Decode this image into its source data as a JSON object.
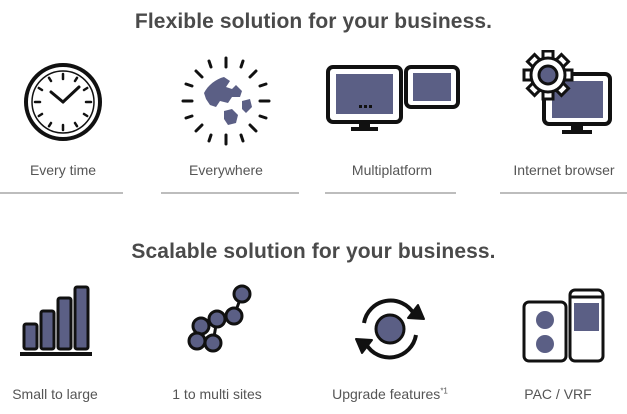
{
  "sections": [
    {
      "title": "Flexible solution for your business.",
      "features": [
        {
          "label": "Every time",
          "icon": "clock-icon"
        },
        {
          "label": "Everywhere",
          "icon": "globe-sun-icon"
        },
        {
          "label": "Multiplatform",
          "icon": "multiple-screens-icon"
        },
        {
          "label": "Internet browser",
          "icon": "monitor-gear-icon"
        }
      ]
    },
    {
      "title": "Scalable solution for your business.",
      "features": [
        {
          "label": "Small to large",
          "icon": "bar-chart-icon"
        },
        {
          "label": "1 to multi sites",
          "icon": "network-nodes-icon"
        },
        {
          "label": "Upgrade features",
          "label_sup": "*1",
          "icon": "refresh-cycle-icon"
        },
        {
          "label": "PAC / VRF",
          "icon": "outdoor-unit-icon"
        }
      ]
    }
  ],
  "colors": {
    "outline": "#111111",
    "fill": "#5b5f85",
    "title": "#4a4a4a",
    "rule": "#bdbdbd"
  }
}
